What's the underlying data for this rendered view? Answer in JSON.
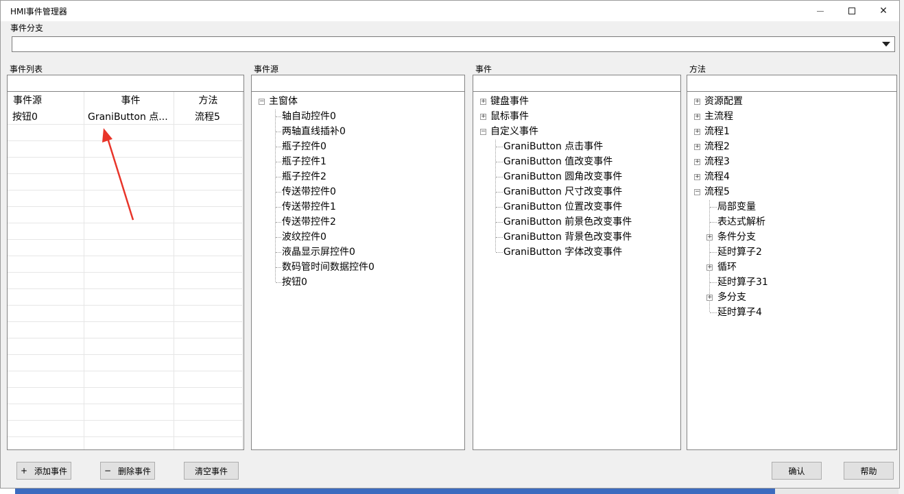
{
  "window": {
    "title": "HMI事件管理器"
  },
  "branch": {
    "label": "事件分支",
    "value": ""
  },
  "event_list": {
    "label": "事件列表",
    "columns": [
      "事件源",
      "事件",
      "方法"
    ],
    "rows": [
      {
        "source": "按钮0",
        "event": "GraniButton 点...",
        "method": "流程5"
      }
    ]
  },
  "event_source": {
    "label": "事件源",
    "root": "主窗体",
    "items": [
      "轴自动控件0",
      "两轴直线插补0",
      "瓶子控件0",
      "瓶子控件1",
      "瓶子控件2",
      "传送带控件0",
      "传送带控件1",
      "传送带控件2",
      "波纹控件0",
      "液晶显示屏控件0",
      "数码管时间数据控件0",
      "按钮0"
    ]
  },
  "events": {
    "label": "事件",
    "groups": [
      "键盘事件",
      "鼠标事件",
      "自定义事件"
    ],
    "custom_items": [
      "GraniButton 点击事件",
      "GraniButton 值改变事件",
      "GraniButton 圆角改变事件",
      "GraniButton 尺寸改变事件",
      "GraniButton 位置改变事件",
      "GraniButton 前景色改变事件",
      "GraniButton 背景色改变事件",
      "GraniButton 字体改变事件"
    ]
  },
  "methods": {
    "label": "方法",
    "top": [
      "资源配置",
      "主流程",
      "流程1",
      "流程2",
      "流程3",
      "流程4",
      "流程5"
    ],
    "flow5_children": [
      "局部变量",
      "表达式解析",
      "条件分支",
      "延时算子2",
      "循环",
      "延时算子31",
      "多分支",
      "延时算子4"
    ]
  },
  "buttons": {
    "add": "添加事件",
    "add_symbol": "+",
    "delete": "删除事件",
    "delete_symbol": "−",
    "clear": "清空事件",
    "confirm": "确认",
    "help": "帮助"
  },
  "colors": {
    "annotation_arrow": "#e8352a",
    "button_bg": "#e1e1e1",
    "window_bg": "#f0f0f0"
  }
}
